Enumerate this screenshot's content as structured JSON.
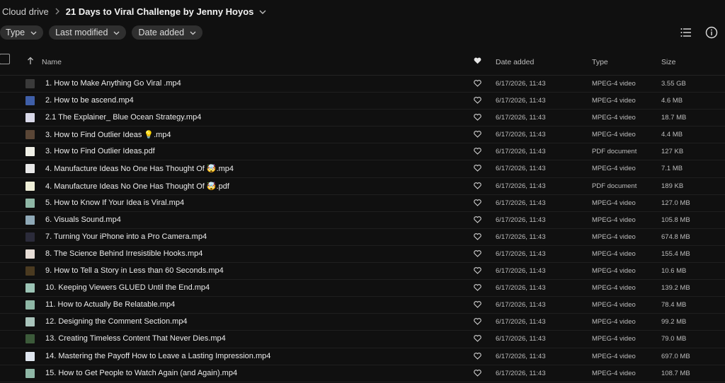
{
  "breadcrumb": {
    "root": "Cloud drive",
    "current": "21 Days to Viral Challenge by Jenny Hoyos"
  },
  "filters": [
    {
      "label": "Type"
    },
    {
      "label": "Last modified"
    },
    {
      "label": "Date added"
    }
  ],
  "columns": {
    "name": "Name",
    "date_added": "Date added",
    "type": "Type",
    "size": "Size"
  },
  "icons": {
    "list_view": "list-view-icon",
    "info": "info-icon",
    "favourite": "heart-icon",
    "sort": "arrow-up-icon"
  },
  "rows": [
    {
      "name": "1. How to Make Anything Go Viral .mp4",
      "date": "6/17/2026, 11:43",
      "type": "MPEG-4 video",
      "size": "3.55 GB",
      "thumb": "#3a3a3a"
    },
    {
      "name": "2. How to be ascend.mp4",
      "date": "6/17/2026, 11:43",
      "type": "MPEG-4 video",
      "size": "4.6 MB",
      "thumb": "#3f5fa8"
    },
    {
      "name": "2.1 The Explainer_ Blue Ocean Strategy.mp4",
      "date": "6/17/2026, 11:43",
      "type": "MPEG-4 video",
      "size": "18.7 MB",
      "thumb": "#d8d8e8"
    },
    {
      "name": "3. How to Find Outlier Ideas 💡.mp4",
      "date": "6/17/2026, 11:43",
      "type": "MPEG-4 video",
      "size": "4.4 MB",
      "thumb": "#5a4636"
    },
    {
      "name": "3. How to Find Outlier Ideas.pdf",
      "date": "6/17/2026, 11:43",
      "type": "PDF document",
      "size": "127 KB",
      "thumb": "#efefe6"
    },
    {
      "name": "4. Manufacture Ideas No One Has Thought Of 🤯.mp4",
      "date": "6/17/2026, 11:43",
      "type": "MPEG-4 video",
      "size": "7.1 MB",
      "thumb": "#e8e8e8"
    },
    {
      "name": "4. Manufacture Ideas No One Has Thought Of 🤯.pdf",
      "date": "6/17/2026, 11:43",
      "type": "PDF document",
      "size": "189 KB",
      "thumb": "#efefd8"
    },
    {
      "name": "5. How to Know If Your Idea is Viral.mp4",
      "date": "6/17/2026, 11:43",
      "type": "MPEG-4 video",
      "size": "127.0 MB",
      "thumb": "#8fb7a6"
    },
    {
      "name": "6. Visuals Sound.mp4",
      "date": "6/17/2026, 11:43",
      "type": "MPEG-4 video",
      "size": "105.8 MB",
      "thumb": "#8fa9b7"
    },
    {
      "name": "7. Turning Your iPhone into a Pro Camera.mp4",
      "date": "6/17/2026, 11:43",
      "type": "MPEG-4 video",
      "size": "674.8 MB",
      "thumb": "#2b2b3a"
    },
    {
      "name": "8. The Science Behind Irresistible Hooks.mp4",
      "date": "6/17/2026, 11:43",
      "type": "MPEG-4 video",
      "size": "155.4 MB",
      "thumb": "#e6ddd6"
    },
    {
      "name": "9. How to Tell a Story in Less than 60 Seconds.mp4",
      "date": "6/17/2026, 11:43",
      "type": "MPEG-4 video",
      "size": "10.6 MB",
      "thumb": "#4a3a20"
    },
    {
      "name": "10. Keeping Viewers GLUED Until the End.mp4",
      "date": "6/17/2026, 11:43",
      "type": "MPEG-4 video",
      "size": "139.2 MB",
      "thumb": "#9cc4b5"
    },
    {
      "name": "11. How to Actually Be Relatable.mp4",
      "date": "6/17/2026, 11:43",
      "type": "MPEG-4 video",
      "size": "78.4 MB",
      "thumb": "#8fb7a6"
    },
    {
      "name": "12. Designing the Comment Section.mp4",
      "date": "6/17/2026, 11:43",
      "type": "MPEG-4 video",
      "size": "99.2 MB",
      "thumb": "#a9c4bb"
    },
    {
      "name": "13. Creating Timeless Content That Never Dies.mp4",
      "date": "6/17/2026, 11:43",
      "type": "MPEG-4 video",
      "size": "79.0 MB",
      "thumb": "#3c5a3a"
    },
    {
      "name": "14. Mastering the Payoff How to Leave a Lasting Impression.mp4",
      "date": "6/17/2026, 11:43",
      "type": "MPEG-4 video",
      "size": "697.0 MB",
      "thumb": "#dfe6ee"
    },
    {
      "name": "15. How to Get People to Watch Again (and Again).mp4",
      "date": "6/17/2026, 11:43",
      "type": "MPEG-4 video",
      "size": "108.7 MB",
      "thumb": "#8fb7a6"
    }
  ]
}
